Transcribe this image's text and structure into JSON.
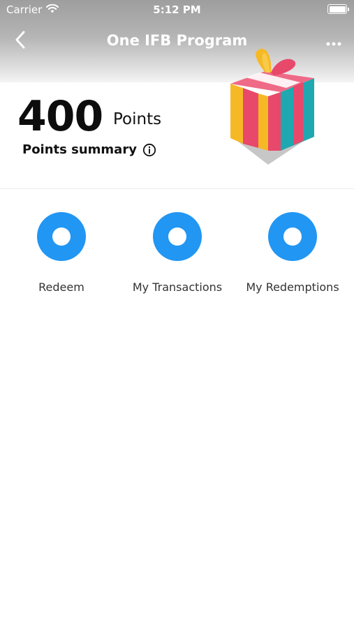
{
  "status_bar": {
    "carrier": "Carrier",
    "time": "5:12 PM"
  },
  "nav": {
    "title": "One IFB Program",
    "back_icon": "chevron-left-icon",
    "more_icon": "more-horizontal-icon"
  },
  "points": {
    "value": "400",
    "unit": "Points",
    "summary_label": "Points summary",
    "info_icon": "info-icon"
  },
  "illustration": {
    "name": "gift-box-illustration",
    "colors": {
      "pink": "#e8486a",
      "yellow": "#f6b926",
      "teal": "#1fa8b0",
      "shadow": "#c7c7c7"
    }
  },
  "actions": [
    {
      "label": "Redeem"
    },
    {
      "label": "My Transactions"
    },
    {
      "label": "My Redemptions"
    }
  ],
  "colors": {
    "accent": "#2196f3"
  }
}
